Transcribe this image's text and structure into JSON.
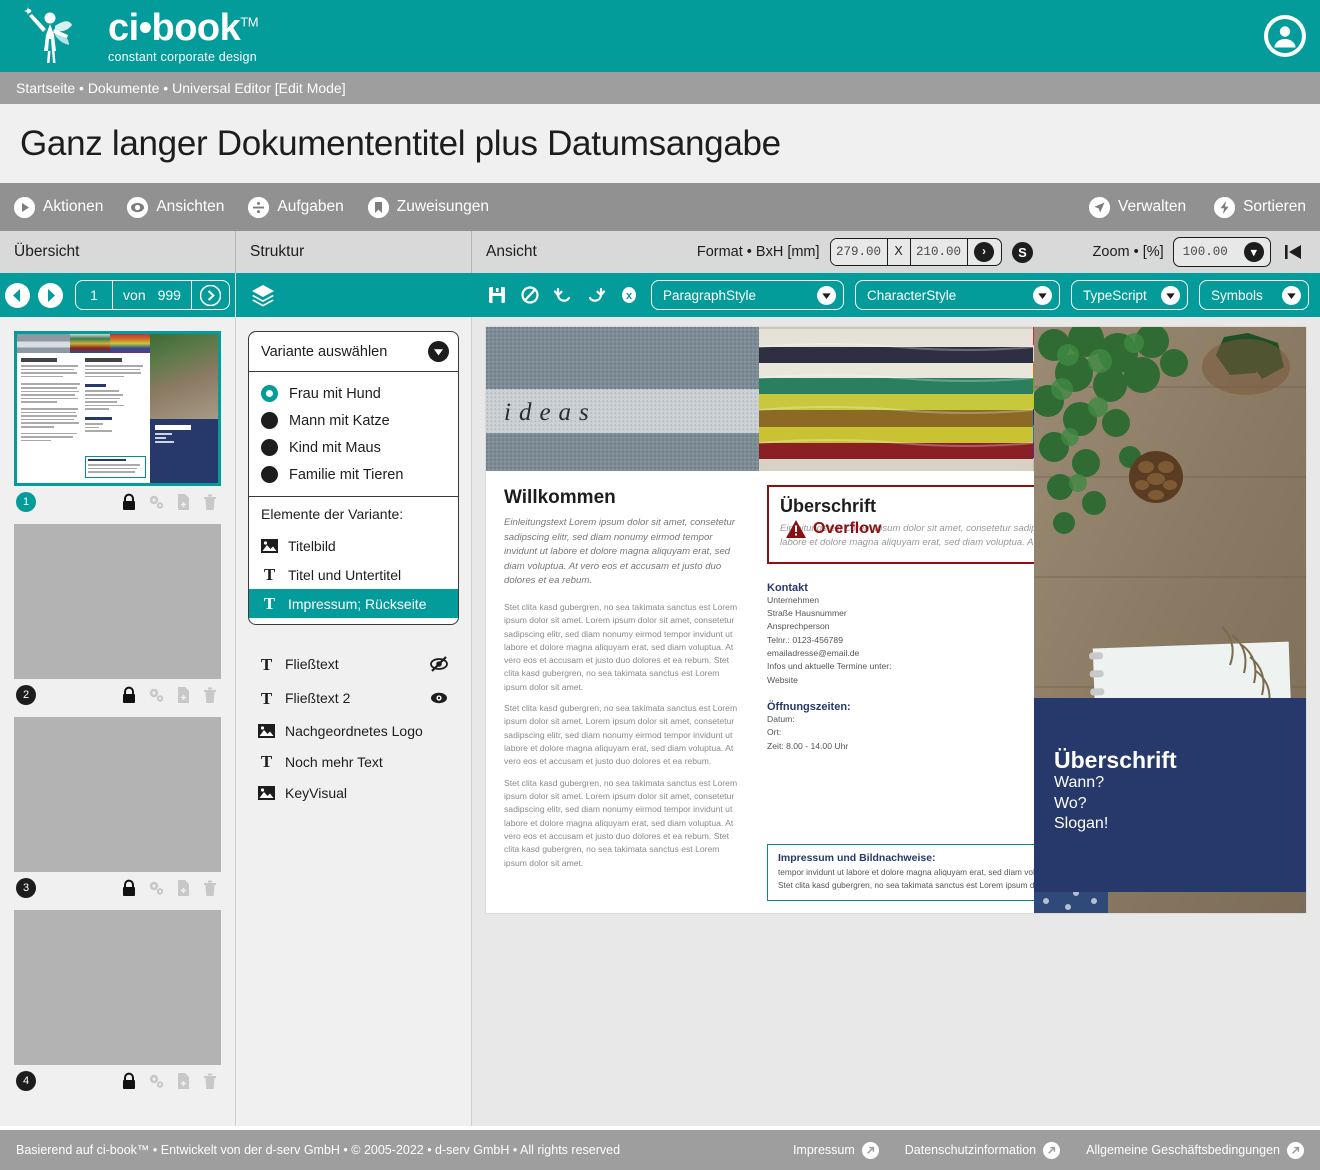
{
  "header": {
    "brand_name": "ci•book",
    "brand_tm": "TM",
    "brand_tagline": "constant corporate design",
    "avatar_icon": "user-avatar-icon"
  },
  "breadcrumb": "Startseite • Dokumente • Universal Editor [Edit Mode]",
  "page_title": "Ganz langer Dokumententitel plus Datumsangabe",
  "action_bar": {
    "left_items": [
      {
        "label": "Aktionen",
        "icon": "play-circle-icon"
      },
      {
        "label": "Ansichten",
        "icon": "eye-circle-icon"
      },
      {
        "label": "Aufgaben",
        "icon": "divide-circle-icon"
      },
      {
        "label": "Zuweisungen",
        "icon": "bookmark-circle-icon"
      }
    ],
    "right_items": [
      {
        "label": "Verwalten",
        "icon": "navigate-circle-icon"
      },
      {
        "label": "Sortieren",
        "icon": "bolt-circle-icon"
      }
    ]
  },
  "panels": {
    "uebersicht_label": "Übersicht",
    "struktur_label": "Struktur",
    "ansicht_label": "Ansicht"
  },
  "format": {
    "label": "Format • BxH [mm]",
    "width": "279.00",
    "x_sep": "X",
    "height": "210.00",
    "apply_icon": "chevron-right-icon",
    "s_button": "S"
  },
  "zoom": {
    "label": "Zoom • [%]",
    "value": "100.00",
    "rewind_icon": "rewind-to-start-icon"
  },
  "pager": {
    "prev_icon": "arrow-left-circle-icon",
    "next_icon": "arrow-right-circle-icon",
    "current": "1",
    "von": "von",
    "total": "999",
    "go_icon": "chevron-right-circle-icon"
  },
  "struktur_toolbar": {
    "layers_icon": "layers-icon"
  },
  "editor_toolbar": {
    "icons": [
      "save-lock-icon",
      "no-style-icon",
      "undo-icon",
      "redo-icon",
      "close-x-icon"
    ],
    "selects": [
      {
        "label": "ParagraphStyle"
      },
      {
        "label": "CharacterStyle"
      },
      {
        "label": "TypeScript"
      },
      {
        "label": "Symbols"
      }
    ]
  },
  "thumbnails": [
    {
      "number": "1",
      "active": true,
      "lock_icon": "lock-icon",
      "settings_icon": "gears-icon",
      "duplicate_icon": "file-plus-icon",
      "delete_icon": "trash-icon"
    },
    {
      "number": "2",
      "active": false,
      "lock_icon": "lock-icon",
      "settings_icon": "gears-icon",
      "duplicate_icon": "file-plus-icon",
      "delete_icon": "trash-icon"
    },
    {
      "number": "3",
      "active": false,
      "lock_icon": "lock-icon",
      "settings_icon": "gears-icon",
      "duplicate_icon": "file-plus-icon",
      "delete_icon": "trash-icon"
    },
    {
      "number": "4",
      "active": false,
      "lock_icon": "lock-icon",
      "settings_icon": "gears-icon",
      "duplicate_icon": "file-plus-icon",
      "delete_icon": "trash-icon"
    }
  ],
  "struktur": {
    "variant_select_label": "Variante auswählen",
    "variants": [
      {
        "label": "Frau mit Hund",
        "selected": true
      },
      {
        "label": "Mann mit Katze",
        "selected": false
      },
      {
        "label": "Kind mit Maus",
        "selected": false
      },
      {
        "label": "Familie mit Tieren",
        "selected": false
      }
    ],
    "elements_header": "Elemente der Variante:",
    "elements": [
      {
        "label": "Titelbild",
        "icon": "image-icon",
        "selected": false
      },
      {
        "label": "Titel und Untertitel",
        "icon": "text-icon",
        "selected": false
      },
      {
        "label": "Impressum; Rückseite",
        "icon": "text-icon",
        "selected": true
      }
    ],
    "extra_elements": [
      {
        "label": "Fließtext",
        "icon": "text-icon",
        "visibility": "hidden",
        "vis_icon": "eye-off-icon"
      },
      {
        "label": "Fließtext 2",
        "icon": "text-icon",
        "visibility": "visible",
        "vis_icon": "eye-icon"
      },
      {
        "label": "Nachgeordnetes Logo",
        "icon": "image-icon",
        "visibility": "",
        "vis_icon": ""
      },
      {
        "label": "Noch mehr Text",
        "icon": "text-icon",
        "visibility": "",
        "vis_icon": ""
      },
      {
        "label": "KeyVisual",
        "icon": "image-icon",
        "visibility": "",
        "vis_icon": ""
      }
    ]
  },
  "document": {
    "left": {
      "heading": "Willkommen",
      "lead": "Einleitungstext Lorem ipsum dolor sit amet, consetetur sadipscing elitr, sed diam nonumy eirmod tempor invidunt ut labore et dolore magna aliquyam erat, sed diam voluptua. At vero eos et accusam et justo duo dolores et ea rebum.",
      "paragraphs": [
        "Stet clita kasd gubergren, no sea takimata sanctus est Lorem ipsum dolor sit amet. Lorem ipsum dolor sit amet, consetetur sadipscing elitr, sed diam nonumy eirmod tempor invidunt ut labore et dolore magna aliquyam erat, sed diam voluptua. At vero eos et accusam et justo duo dolores et ea rebum. Stet clita kasd gubergren, no sea takimata sanctus est Lorem ipsum dolor sit amet.",
        "Stet clita kasd gubergren, no sea takimata sanctus est Lorem ipsum dolor sit amet. Lorem ipsum dolor sit amet, consetetur sadipscing elitr, sed diam nonumy eirmod tempor invidunt ut labore et dolore magna aliquyam erat, sed diam voluptua. At vero eos et accusam et justo duo dolores et ea rebum.",
        "Stet clita kasd gubergren, no sea takimata sanctus est Lorem ipsum dolor sit amet. Lorem ipsum dolor sit amet, consetetur sadipscing elitr, sed diam nonumy eirmod tempor invidunt ut labore et dolore magna aliquyam erat, sed diam voluptua. At vero eos et accusam et justo duo dolores et ea rebum. Stet clita kasd gubergren, no sea takimata sanctus est Lorem ipsum dolor sit amet."
      ]
    },
    "overflow_box": {
      "title": "Überschrift",
      "close_label": "✕",
      "warning_label": "Overflow",
      "warning_icon": "warning-triangle-icon",
      "text": "Einleitungstext Lorem ipsum dolor sit amet, consetetur sadipscing elitr, sed diam nonumy eirmod tempor invidunt ut labore et dolore magna aliquyam erat, sed diam voluptua. At vero eos et accusam et justo duo dolores et ea rebum."
    },
    "kontakt": {
      "heading": "Kontakt",
      "lines": [
        "Unternehmen",
        "Straße Hausnummer",
        "Ansprechperson",
        "Telnr.: 0123-456789",
        "emailadresse@email.de",
        "Infos und aktuelle Termine unter:",
        "Website"
      ]
    },
    "oeffnungszeiten": {
      "heading": "Öffnungszeiten:",
      "lines": [
        "Datum:",
        "Ort:",
        "Zeit: 8.00 - 14.00 Uhr"
      ]
    },
    "impressum": {
      "heading": "Impressum und Bildnachweise:",
      "text": "tempor invidunt ut labore et dolore magna aliquyam erat, sed diam voluptua. At vero eos et accusam et justo duo dolores et ea rebum. Stet clita kasd gubergren, no sea takimata sanctus est Lorem ipsum dolor sit amet."
    },
    "blue_panel": {
      "heading": "Überschrift",
      "line1": "Wann?",
      "line2": "Wo?",
      "line3": "Slogan!"
    },
    "images": {
      "ideas_caption": "ideas"
    }
  },
  "footer": {
    "copyright": "Basierend auf ci-book™ • Entwickelt von der d-serv GmbH • © 2005-2022 • d-serv GmbH • All rights reserved",
    "links": [
      {
        "label": "Impressum",
        "icon": "external-link-icon"
      },
      {
        "label": "Datenschutzinformation",
        "icon": "external-link-icon"
      },
      {
        "label": "Allgemeine Geschäftsbedingungen",
        "icon": "external-link-icon"
      }
    ]
  },
  "colors": {
    "brand_teal": "#049b9b",
    "gray_bar": "#9e9e9e",
    "action_gray": "#919191",
    "panel_gray": "#d9d9d9",
    "navy": "#27386b",
    "overflow_red": "#8b1111"
  }
}
